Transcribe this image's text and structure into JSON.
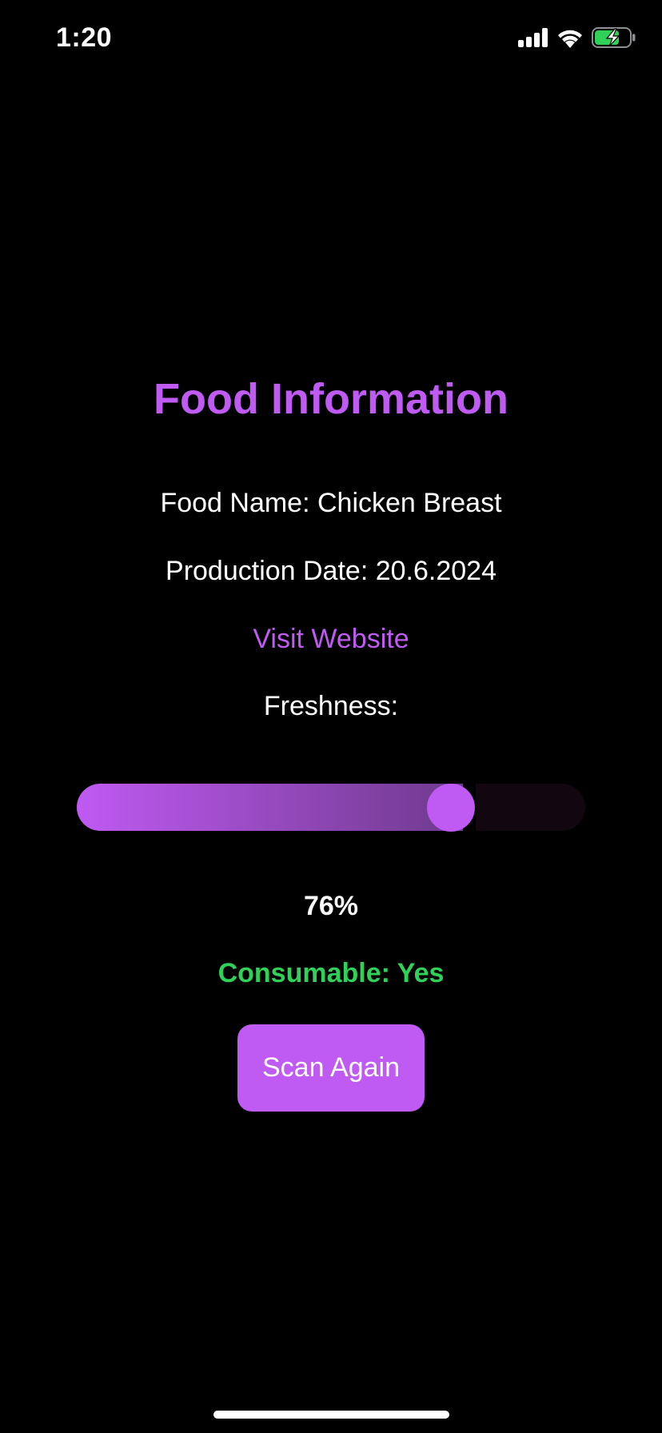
{
  "status_bar": {
    "time": "1:20",
    "icons": [
      "cellular-signal-icon",
      "wifi-icon",
      "battery-charging-icon"
    ]
  },
  "food_info": {
    "title": "Food Information",
    "food_name": "Food Name: Chicken Breast",
    "production_date": "Production Date: 20.6.2024",
    "website_link": "Visit Website",
    "freshness_label": "Freshness:",
    "freshness_value": 0.76,
    "freshness_percent": "76%",
    "consumable": "Consumable: Yes"
  },
  "actions": {
    "scan_again": "Scan Again"
  },
  "colors": {
    "accent": "#bf5af2",
    "accent_dark": "#6e3a8c",
    "success": "#30d158",
    "text": "#ffffff",
    "background": "#000000",
    "battery": "#30d158"
  }
}
